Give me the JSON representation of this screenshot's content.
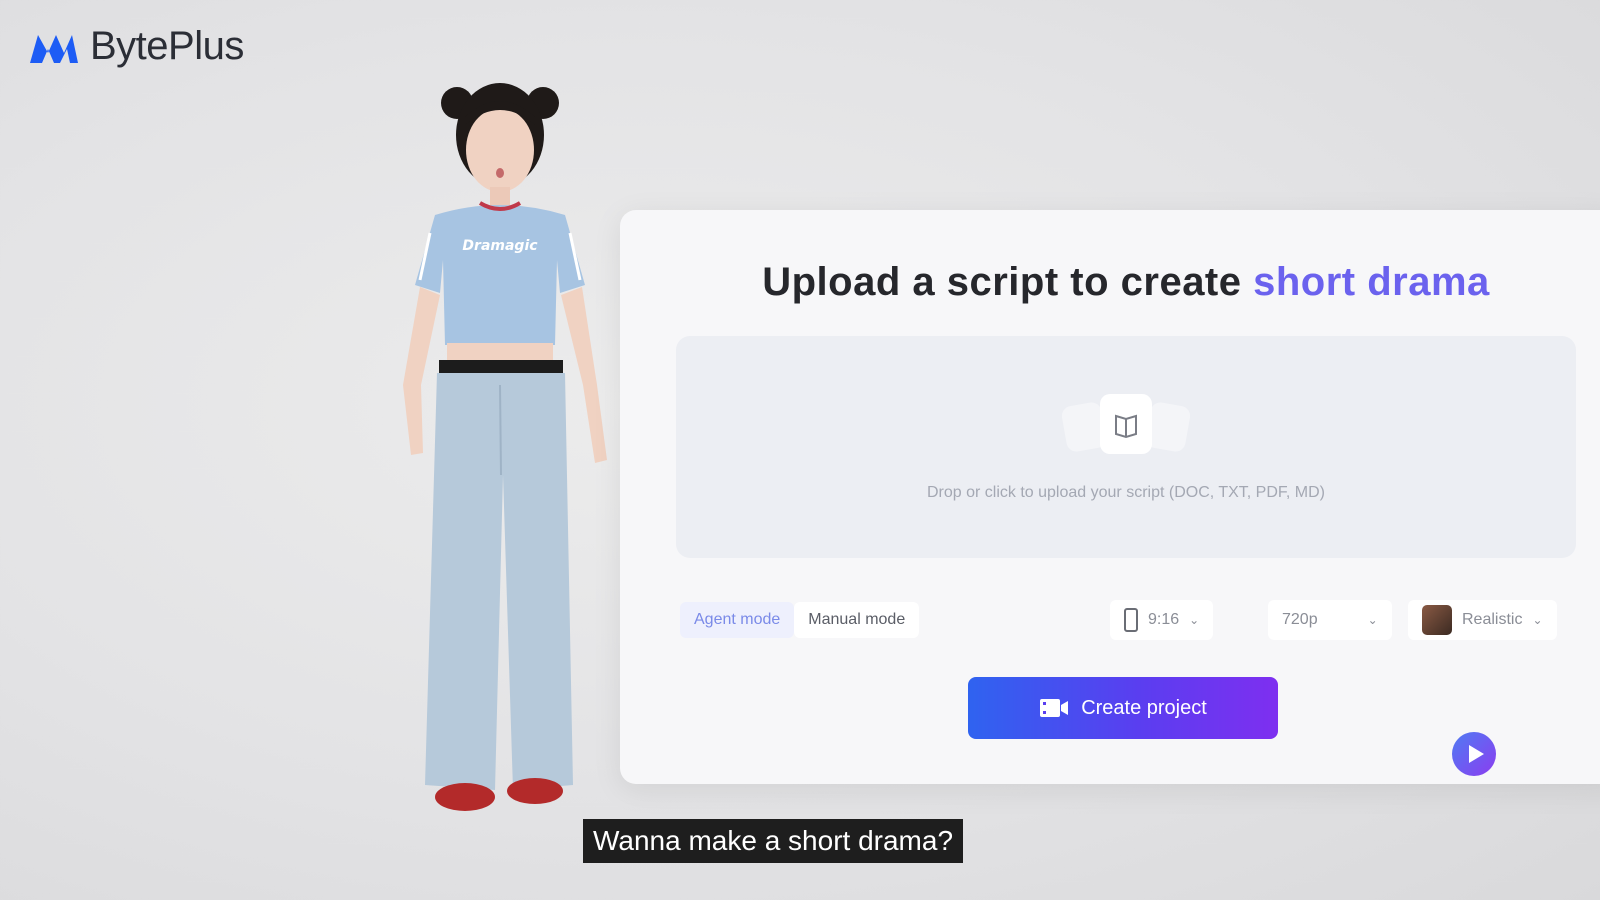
{
  "brand": {
    "name": "BytePlus"
  },
  "person": {
    "shirt_text": "Dramagic"
  },
  "panel": {
    "title_prefix": "Upload a script to create ",
    "title_accent": "short drama",
    "upload_hint": "Drop or click to upload your script (DOC, TXT, PDF, MD)",
    "modes": [
      {
        "label": "Agent mode",
        "active": true
      },
      {
        "label": "Manual mode",
        "active": false
      }
    ],
    "aspect_ratio": "9:16",
    "resolution": "720p",
    "style": "Realistic",
    "create_button": "Create project"
  },
  "caption": "Wanna make a short drama?",
  "colors": {
    "accent": "#6b62ee",
    "button_start": "#2f63f0",
    "button_end": "#7e2ff0",
    "brand_blue": "#1d5cf5"
  },
  "icons": [
    "byteplus-logo-icon",
    "book-icon",
    "phone-icon",
    "chevron-down-icon",
    "film-icon",
    "play-icon"
  ]
}
